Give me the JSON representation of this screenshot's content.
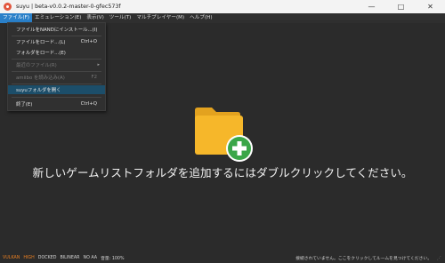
{
  "window": {
    "title": "suyu | beta-v0.0.2-master-0-gfec573f",
    "minimize": "—",
    "maximize": "□",
    "close": "✕"
  },
  "menubar": {
    "items": [
      {
        "label": "ファイル(F)"
      },
      {
        "label": "エミュレーション(E)"
      },
      {
        "label": "表示(V)"
      },
      {
        "label": "ツール(T)"
      },
      {
        "label": "マルチプレイヤー(M)"
      },
      {
        "label": "ヘルプ(H)"
      }
    ]
  },
  "file_menu": {
    "install": {
      "label": "ファイルをNANDにインストール...(I)"
    },
    "load_file": {
      "label": "ファイルをロード...(L)",
      "shortcut": "Ctrl+O"
    },
    "load_folder": {
      "label": "フォルダをロード...(E)"
    },
    "recent_files": {
      "label": "最近のファイル(R)"
    },
    "amiibo": {
      "label": "amiibo を読み込み(A)",
      "shortcut": "F2"
    },
    "open_suyu_folder": {
      "label": "suyuフォルダを開く"
    },
    "exit": {
      "label": "終了(E)",
      "shortcut": "Ctrl+Q"
    }
  },
  "main": {
    "hint": "新しいゲームリストフォルダを追加するにはダブルクリックしてください。",
    "folder_icon_color": "#f6b72a",
    "plus_badge_color": "#3aa648"
  },
  "statusbar": {
    "items": [
      {
        "label": "VULKAN",
        "color": "#e67e22"
      },
      {
        "label": "HIGH",
        "color": "#e67e22"
      },
      {
        "label": "DOCKED"
      },
      {
        "label": "BILINEAR"
      },
      {
        "label": "NO AA"
      },
      {
        "label": "音量: 100%"
      }
    ],
    "right_text": "接続されていません。ここをクリックしてルームを見つけてください。"
  },
  "colors": {
    "menu_active": "#2a80c9",
    "menu_hover_row": "#1c4e6a",
    "background": "#2b2b2b"
  }
}
